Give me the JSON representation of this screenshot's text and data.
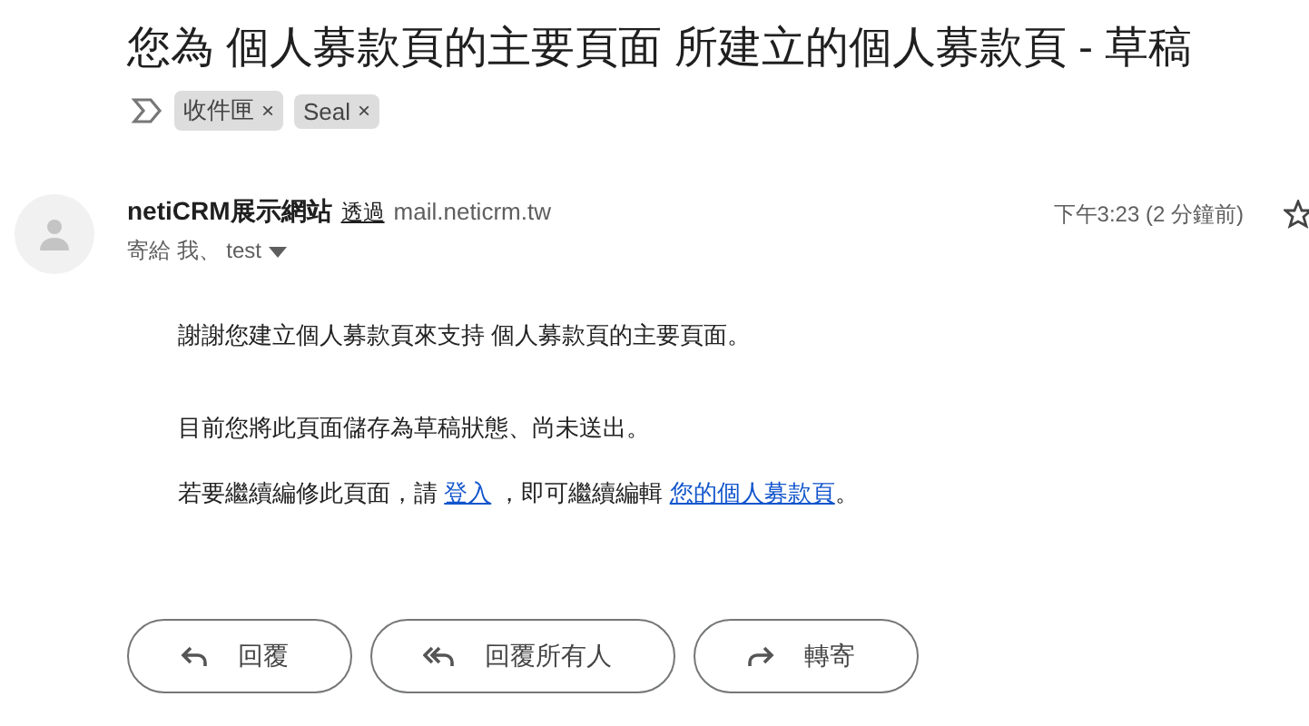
{
  "subject": "您為 個人募款頁的主要頁面 所建立的個人募款頁 - 草稿",
  "labels": [
    {
      "text": "收件匣",
      "remove": "×"
    },
    {
      "text": "Seal",
      "remove": "×"
    }
  ],
  "message": {
    "sender_name": "netiCRM展示網站",
    "via": "透過",
    "via_domain": "mail.neticrm.tw",
    "time": "下午3:23 (2 分鐘前)",
    "recipients": "寄給 我、 test",
    "body": [
      [
        {
          "kind": "text",
          "text": "謝謝您建立個人募款頁來支持 個人募款頁的主要頁面。"
        }
      ],
      [
        {
          "kind": "text",
          "text": "目前您將此頁面儲存為草稿狀態、尚未送出。"
        }
      ],
      [
        {
          "kind": "text",
          "text": "若要繼續編修此頁面，請 "
        },
        {
          "kind": "link",
          "text": "登入"
        },
        {
          "kind": "text",
          "text": " ，即可繼續編輯 "
        },
        {
          "kind": "link",
          "text": "您的個人募款頁"
        },
        {
          "kind": "text",
          "text": "。"
        }
      ]
    ]
  },
  "actions": [
    {
      "kind": "reply",
      "label": "回覆"
    },
    {
      "kind": "reply_all",
      "label": "回覆所有人"
    },
    {
      "kind": "forward",
      "label": "轉寄"
    }
  ]
}
